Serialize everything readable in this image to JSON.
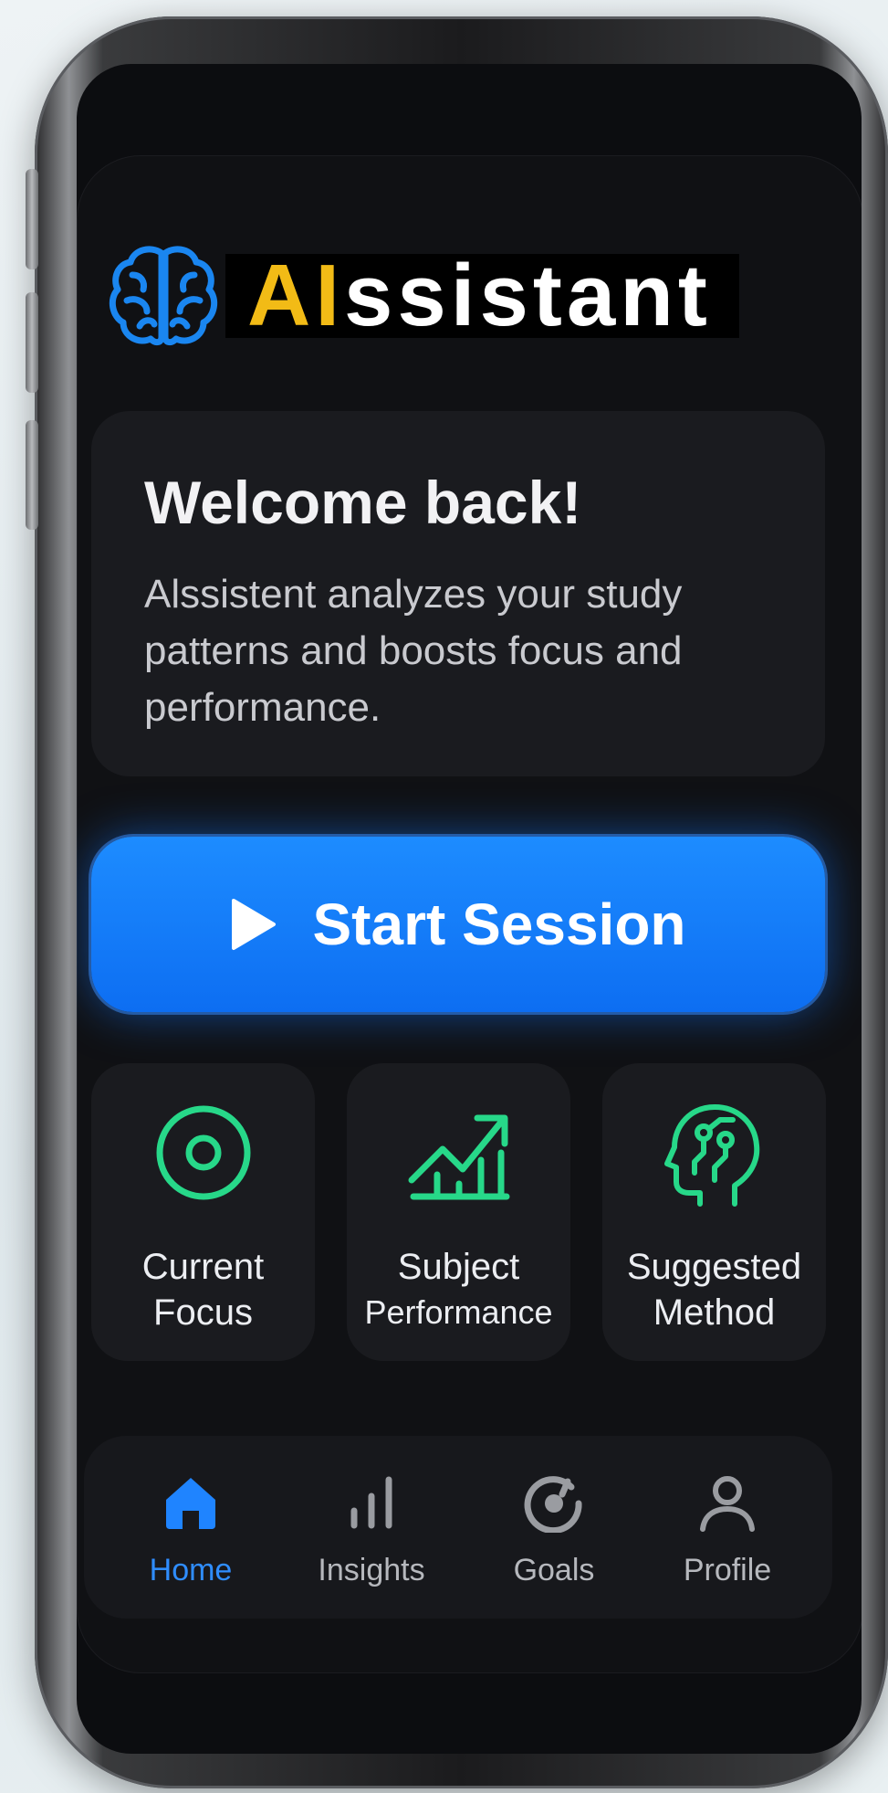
{
  "brand": {
    "name_highlight": "AI",
    "name_rest": "ssistant",
    "icon": "brain-icon",
    "highlight_color": "#f2bb16",
    "icon_color": "#1a86f0"
  },
  "welcome": {
    "title": "Welcome back!",
    "description": "Alssistent analyzes your study patterns and boosts focus and performance."
  },
  "primary_action": {
    "label": "Start Session",
    "icon": "play-icon",
    "color": "#0d6ef2"
  },
  "tiles": [
    {
      "line1": "Current",
      "line2": "Focus",
      "icon": "target-icon"
    },
    {
      "line1": "Subject",
      "line2": "Performance",
      "icon": "trend-chart-icon"
    },
    {
      "line1": "Suggested",
      "line2": "Method",
      "icon": "head-circuit-icon"
    }
  ],
  "accent_green": "#27d889",
  "nav": {
    "items": [
      {
        "label": "Home",
        "icon": "home-icon",
        "active": true
      },
      {
        "label": "Insights",
        "icon": "bars-icon",
        "active": false
      },
      {
        "label": "Goals",
        "icon": "goal-icon",
        "active": false
      },
      {
        "label": "Profile",
        "icon": "user-icon",
        "active": false
      }
    ],
    "active_color": "#2f8dff"
  }
}
